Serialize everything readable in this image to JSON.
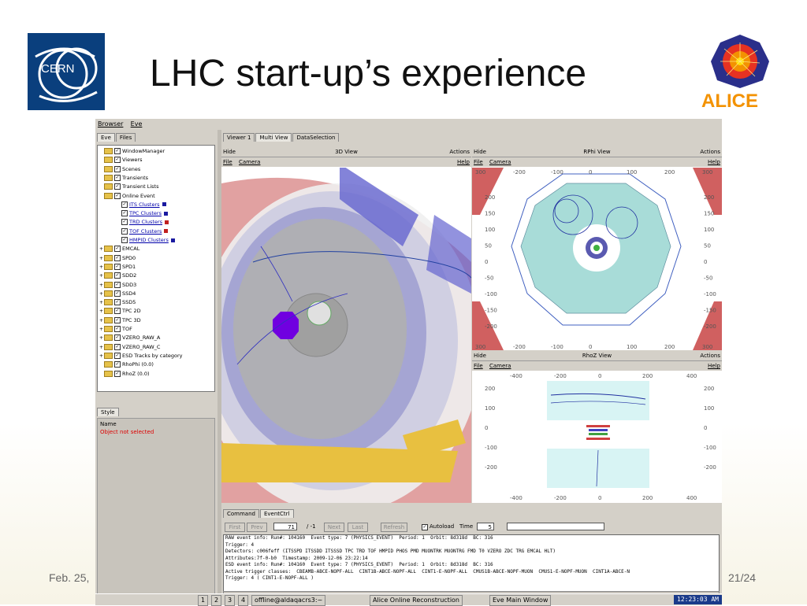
{
  "slide": {
    "title": "LHC start-up’s experience",
    "footer_left": "Feb. 25,",
    "footer_right": "21/24",
    "cern_logo_text": "CERN",
    "alice_logo_text": "ALICE"
  },
  "window": {
    "menu": [
      "Browser",
      "Eve"
    ],
    "left_tabs": [
      "Eve",
      "Files"
    ],
    "tree": [
      {
        "label": "WindowManager",
        "level": 0
      },
      {
        "label": "Viewers",
        "level": 0
      },
      {
        "label": "Scenes",
        "level": 0
      },
      {
        "label": "Transients",
        "level": 0
      },
      {
        "label": "Transient Lists",
        "level": 0
      },
      {
        "label": "Online Event",
        "level": 0
      },
      {
        "label": "ITS Clusters",
        "level": 1,
        "color": "#1a1aa0"
      },
      {
        "label": "TPC Clusters",
        "level": 1,
        "color": "#1a1aa0"
      },
      {
        "label": "TRD Clusters",
        "level": 1,
        "color": "#c02020"
      },
      {
        "label": "TOF Clusters",
        "level": 1,
        "color": "#c02020"
      },
      {
        "label": "HMPID Clusters",
        "level": 1,
        "color": "#1a1aa0"
      },
      {
        "label": "EMCAL",
        "level": 0
      },
      {
        "label": "SPD0",
        "level": 0
      },
      {
        "label": "SPD1",
        "level": 0
      },
      {
        "label": "SDD2",
        "level": 0
      },
      {
        "label": "SDD3",
        "level": 0
      },
      {
        "label": "SSD4",
        "level": 0
      },
      {
        "label": "SSD5",
        "level": 0
      },
      {
        "label": "TPC 2D",
        "level": 0
      },
      {
        "label": "TPC 3D",
        "level": 0
      },
      {
        "label": "TOF",
        "level": 0
      },
      {
        "label": "VZERO_RAW_A",
        "level": 0
      },
      {
        "label": "VZERO_RAW_C",
        "level": 0
      },
      {
        "label": "ESD Tracks by category",
        "level": 0
      },
      {
        "label": "RhoPhi (0.0)",
        "level": -1
      },
      {
        "label": "RhoZ (0.0)",
        "level": -1
      }
    ],
    "style_tab": "Style",
    "style_name_label": "Name",
    "style_message": "Object not selected",
    "right_tabs": [
      "Viewer 1",
      "Multi View",
      "DataSelection"
    ],
    "view3d": {
      "hide": "Hide",
      "title": "3D View",
      "actions": "Actions",
      "menu": [
        "File",
        "Camera"
      ],
      "help": "Help"
    },
    "rphi": {
      "hide": "Hide",
      "title": "RPhi View",
      "actions": "Actions",
      "menu": [
        "File",
        "Camera"
      ],
      "help": "Help",
      "x_ticks": [
        "300",
        "-200",
        "-100",
        "0",
        "100",
        "200",
        "300"
      ],
      "y_ticks_left": [
        "200",
        "150",
        "100",
        "50",
        "0",
        "-50",
        "-100",
        "-150",
        "-200"
      ],
      "y_ticks_right": [
        "200",
        "150",
        "100",
        "50",
        "0",
        "-50",
        "-100",
        "-150",
        "-200"
      ]
    },
    "rhoz": {
      "hide": "Hide",
      "title": "RhoZ View",
      "actions": "Actions",
      "menu": [
        "File",
        "Camera"
      ],
      "help": "Help",
      "x_ticks_top": [
        "-400",
        "-200",
        "0",
        "200",
        "400"
      ],
      "x_ticks_bottom": [
        "-400",
        "-200",
        "0",
        "200",
        "400"
      ],
      "y_ticks_left": [
        "200",
        "100",
        "0",
        "-100",
        "-200"
      ],
      "y_ticks_right": [
        "200",
        "100",
        "0",
        "-100",
        "-200"
      ]
    },
    "bottom_tabs": [
      "Command",
      "EventCtrl"
    ],
    "controls": {
      "first": "First",
      "prev": "Prev",
      "event_no": "71",
      "of": "/ -1",
      "next": "Next",
      "last": "Last",
      "refresh": "Refresh",
      "autoload": "Autoload",
      "time_label": "Time",
      "time_value": "5"
    },
    "log": [
      "RAW event info: Run#: 104160  Event type: 7 (PHYSICS_EVENT)  Period: 1  Orbit: 8d318d  BC: 316",
      "Trigger: 4",
      "Detectors: c006feff (ITSSPD ITSSDD ITSSSD TPC TRD TOF HMPID PHOS PMD MUONTRK MUONTRG FMD T0 VZERO ZDC TRG EMCAL HLT)",
      "Attributes:7f-0-b0  Timestamp: 2009-12-06 23:22:14",
      "ESD event info: Run#: 104160  Event type: 7 (PHYSICS_EVENT)  Period: 1  Orbit: 8d318d  BC: 316",
      "Active trigger classes:  CBEAMB-ABCE-NOPF-ALL  CINT1B-ABCE-NOPF-ALL  CINT1-E-NOPF-ALL  CMUS1B-ABCE-NOPF-MUON  CMUS1-E-NOPF-MUON  CINT1A-ABCE-N",
      "Trigger: 4 ( CINT1-E-NOPF-ALL )"
    ]
  },
  "taskbar": {
    "workspaces": [
      "1",
      "2",
      "3",
      "4"
    ],
    "tasks": [
      "offline@aldaqacrs3:~",
      "Alice Online Reconstruction",
      "Eve Main Window"
    ],
    "clock": "12:23:03 AM"
  },
  "colors": {
    "cern_blue": "#0a3f7d",
    "alice_red": "#e63222",
    "alice_orange": "#f39200",
    "tpc_cyan": "#a8dcd8"
  }
}
